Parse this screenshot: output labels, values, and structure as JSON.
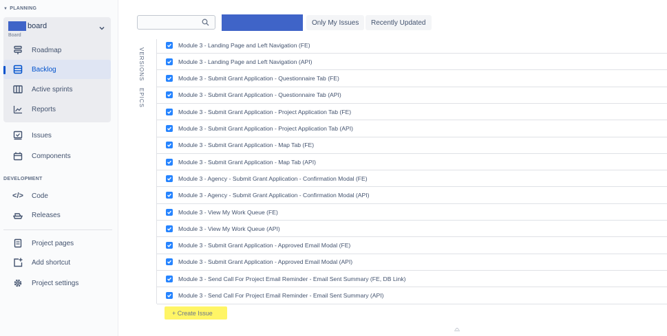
{
  "sidebar": {
    "planning_label": "PLANNING",
    "board": {
      "name": "board",
      "subtitle": "Board"
    },
    "items": [
      {
        "label": "Roadmap",
        "icon": "roadmap-icon"
      },
      {
        "label": "Backlog",
        "icon": "backlog-icon",
        "active": true
      },
      {
        "label": "Active sprints",
        "icon": "board-columns-icon"
      },
      {
        "label": "Reports",
        "icon": "chart-icon"
      },
      {
        "label": "Issues",
        "icon": "issues-icon"
      },
      {
        "label": "Components",
        "icon": "components-icon"
      }
    ],
    "development_label": "DEVELOPMENT",
    "dev_items": [
      {
        "label": "Code",
        "icon": "code-icon"
      },
      {
        "label": "Releases",
        "icon": "ship-icon"
      }
    ],
    "bottom_items": [
      {
        "label": "Project pages",
        "icon": "page-icon"
      },
      {
        "label": "Add shortcut",
        "icon": "add-shortcut-icon"
      },
      {
        "label": "Project settings",
        "icon": "gear-icon"
      }
    ]
  },
  "toolbar": {
    "search": {
      "value": "",
      "placeholder": ""
    },
    "filters": [
      "Only My Issues",
      "Recently Updated"
    ]
  },
  "vertical_tabs": [
    "VERSIONS",
    "EPICS"
  ],
  "issues": [
    "Module 3 - Landing Page and Left Navigation (FE)",
    "Module 3 - Landing Page and Left Navigation (API)",
    "Module 3 - Submit Grant Application - Questionnaire Tab (FE)",
    "Module 3 - Submit Grant Application - Questionnaire Tab (API)",
    "Module 3 - Submit Grant Application - Project Application Tab (FE)",
    "Module 3 - Submit Grant Application - Project Application Tab (API)",
    "Module 3 - Submit Grant Application - Map Tab (FE)",
    "Module 3 - Submit Grant Application - Map Tab (API)",
    "Module 3 - Agency - Submit Grant Application - Confirmation Modal (FE)",
    "Module 3 - Agency - Submit Grant Application - Confirmation Modal (API)",
    "Module 3 - View My Work Queue (FE)",
    "Module 3 - View My Work Queue (API)",
    "Module 3 - Submit Grant Application - Approved Email Modal (FE)",
    "Module 3 - Submit Grant Application - Approved Email Modal (API)",
    "Module 3 - Send Call For Project Email Reminder - Email Sent Summary (FE, DB Link)",
    "Module 3 - Send Call For Project Email Reminder - Email Sent Summary (API)"
  ],
  "create_issue": {
    "label": "+ Create Issue"
  },
  "colors": {
    "accent": "#0052cc",
    "checkbox": "#2684ff",
    "highlight": "#fff566",
    "redaction": "#3f64c8"
  }
}
